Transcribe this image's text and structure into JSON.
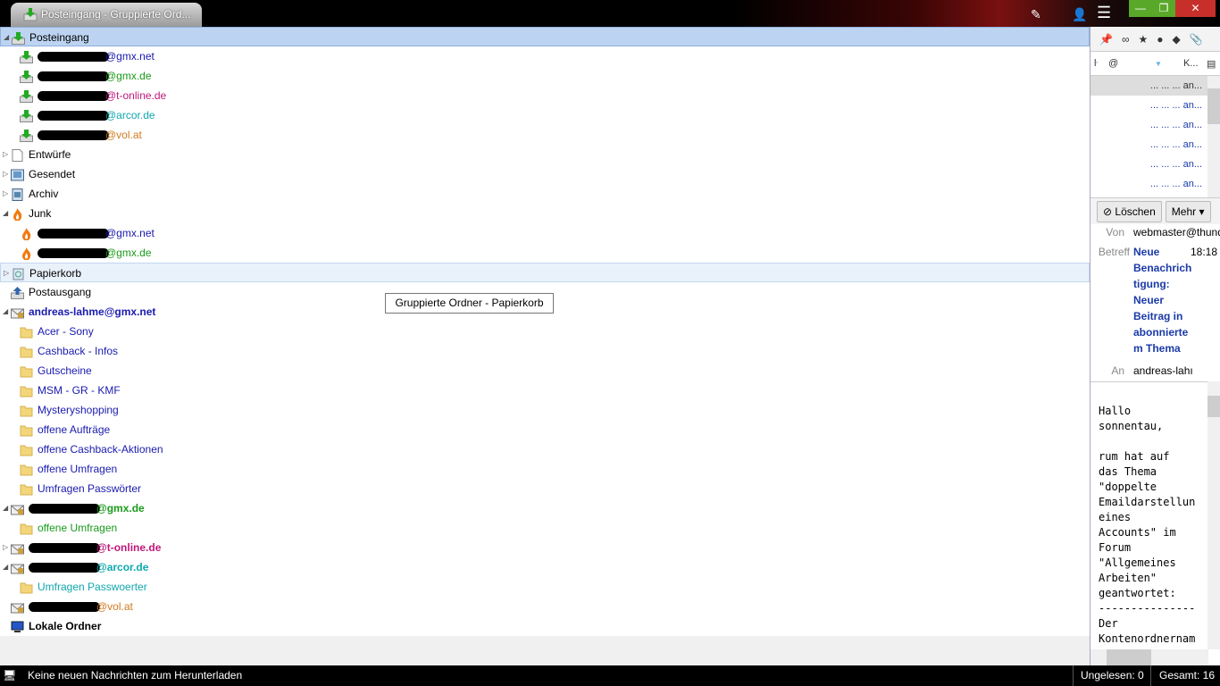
{
  "window": {
    "tab_title": "Posteingang - Gruppierte Ord...",
    "window_buttons": [
      "—",
      "❐",
      "✕"
    ]
  },
  "colors": {
    "blue": "#1a1ab0",
    "green": "#1a9a1a",
    "pink": "#c0187a",
    "cyan": "#10a8b0",
    "orange": "#d07a20",
    "black": "#000000"
  },
  "tree": [
    {
      "label": "Posteingang",
      "icon": "inbox-icon",
      "indent": 0,
      "twisty": "open",
      "color": "black",
      "state": "sel"
    },
    {
      "label": "@gmx.net",
      "redacted": true,
      "icon": "inbox-icon",
      "indent": 1,
      "color": "blue"
    },
    {
      "label": "@gmx.de",
      "redacted": true,
      "icon": "inbox-icon",
      "indent": 1,
      "color": "green"
    },
    {
      "label": "@t-online.de",
      "redacted": true,
      "icon": "inbox-icon",
      "indent": 1,
      "color": "pink"
    },
    {
      "label": "@arcor.de",
      "redacted": true,
      "icon": "inbox-icon",
      "indent": 1,
      "color": "cyan"
    },
    {
      "label": "@vol.at",
      "redacted": true,
      "icon": "inbox-icon",
      "indent": 1,
      "color": "orange"
    },
    {
      "label": "Entwürfe",
      "icon": "drafts-icon",
      "indent": 0,
      "twisty": "closed",
      "color": "black"
    },
    {
      "label": "Gesendet",
      "icon": "sent-icon",
      "indent": 0,
      "twisty": "closed",
      "color": "black"
    },
    {
      "label": "Archiv",
      "icon": "archive-icon",
      "indent": 0,
      "twisty": "closed",
      "color": "black"
    },
    {
      "label": "Junk",
      "icon": "junk-icon",
      "indent": 0,
      "twisty": "open",
      "color": "black"
    },
    {
      "label": "@gmx.net",
      "redacted": true,
      "icon": "junk-icon",
      "indent": 1,
      "color": "blue"
    },
    {
      "label": "@gmx.de",
      "redacted": true,
      "icon": "junk-icon",
      "indent": 1,
      "color": "green"
    },
    {
      "label": "Papierkorb",
      "icon": "trash-icon",
      "indent": 0,
      "twisty": "closed",
      "color": "black",
      "state": "hov"
    },
    {
      "label": "Postausgang",
      "icon": "outbox-icon",
      "indent": 0,
      "color": "black"
    },
    {
      "label": "andreas-lahme@gmx.net",
      "icon": "account-icon",
      "indent": 0,
      "twisty": "open",
      "color": "blue",
      "bold": true
    },
    {
      "label": "Acer - Sony",
      "icon": "folder-icon",
      "indent": 1,
      "color": "blue"
    },
    {
      "label": "Cashback - Infos",
      "icon": "folder-icon",
      "indent": 1,
      "color": "blue"
    },
    {
      "label": "Gutscheine",
      "icon": "folder-icon",
      "indent": 1,
      "color": "blue"
    },
    {
      "label": "MSM - GR - KMF",
      "icon": "folder-icon",
      "indent": 1,
      "color": "blue"
    },
    {
      "label": "Mysteryshopping",
      "icon": "folder-icon",
      "indent": 1,
      "color": "blue"
    },
    {
      "label": "offene Aufträge",
      "icon": "folder-icon",
      "indent": 1,
      "color": "blue"
    },
    {
      "label": "offene Cashback-Aktionen",
      "icon": "folder-icon",
      "indent": 1,
      "color": "blue"
    },
    {
      "label": "offene Umfragen",
      "icon": "folder-icon",
      "indent": 1,
      "color": "blue"
    },
    {
      "label": "Umfragen Passwörter",
      "icon": "folder-icon",
      "indent": 1,
      "color": "blue"
    },
    {
      "label": "@gmx.de",
      "redacted": true,
      "icon": "account-icon",
      "indent": 0,
      "twisty": "open",
      "color": "green",
      "bold": true
    },
    {
      "label": "offene Umfragen",
      "icon": "folder-icon",
      "indent": 1,
      "color": "green"
    },
    {
      "label": "@t-online.de",
      "redacted": true,
      "icon": "account-icon",
      "indent": 0,
      "twisty": "closed",
      "color": "pink",
      "bold": true
    },
    {
      "label": "@arcor.de",
      "redacted": true,
      "icon": "account-icon",
      "indent": 0,
      "twisty": "open",
      "color": "cyan",
      "bold": true
    },
    {
      "label": "Umfragen Passwoerter",
      "icon": "folder-icon",
      "indent": 1,
      "color": "cyan"
    },
    {
      "label": "@vol.at",
      "redacted": true,
      "icon": "account-icon",
      "indent": 0,
      "color": "orange"
    },
    {
      "label": "Lokale Ordner",
      "icon": "local-folders-icon",
      "indent": 0,
      "color": "black",
      "bold": true
    }
  ],
  "tooltip": "Gruppierte Ordner - Papierkorb",
  "message_list": {
    "column_sort": "K...",
    "rows": [
      "... ... ... an...",
      "... ... ... an...",
      "... ... ... an...",
      "... ... ... an...",
      "... ... ... an...",
      "... ... ... an..."
    ]
  },
  "message_header": {
    "delete_label": "Löschen",
    "more_label": "Mehr",
    "from_key": "Von",
    "from": "webmaster@thund",
    "subject_key": "Betreff",
    "subject": "Neue Benachrich tigung: Neuer Beitrag in abonnierte m Thema",
    "time": "18:18",
    "to_key": "An",
    "to": "andreas-lahı"
  },
  "message_body": "Hallo\nsonnentau,\n\nrum hat auf\ndas Thema\n\"doppelte\nEmaildarstellun\neines\nAccounts\" im\nForum\n\"Allgemeines\nArbeiten\"\ngeantwortet:\n---------------\nDer\nKontenordnernam",
  "status": {
    "text": "Keine neuen Nachrichten zum Herunterladen",
    "unread": "Ungelesen: 0",
    "total": "Gesamt: 16"
  }
}
